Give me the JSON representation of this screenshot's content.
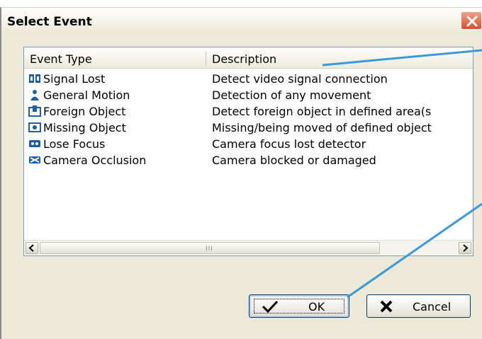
{
  "dialog": {
    "title": "Select Event"
  },
  "list": {
    "headers": {
      "event_type": "Event Type",
      "description": "Description"
    },
    "rows": [
      {
        "icon": "signal-lost-icon",
        "name": "Signal Lost",
        "description": "Detect video signal connection"
      },
      {
        "icon": "general-motion-icon",
        "name": "General Motion",
        "description": "Detection of any movement"
      },
      {
        "icon": "foreign-object-icon",
        "name": "Foreign Object",
        "description": "Detect foreign object in defined area(s"
      },
      {
        "icon": "missing-object-icon",
        "name": "Missing Object",
        "description": "Missing/being moved of defined object"
      },
      {
        "icon": "lose-focus-icon",
        "name": "Lose Focus",
        "description": "Camera focus lost detector"
      },
      {
        "icon": "camera-occlusion-icon",
        "name": "Camera Occlusion",
        "description": "Camera blocked or damaged"
      }
    ],
    "scroll_grip": "III"
  },
  "buttons": {
    "ok": "OK",
    "cancel": "Cancel"
  },
  "colors": {
    "icon_blue": "#1c5ea8",
    "callout_line": "#3a9ad9"
  }
}
